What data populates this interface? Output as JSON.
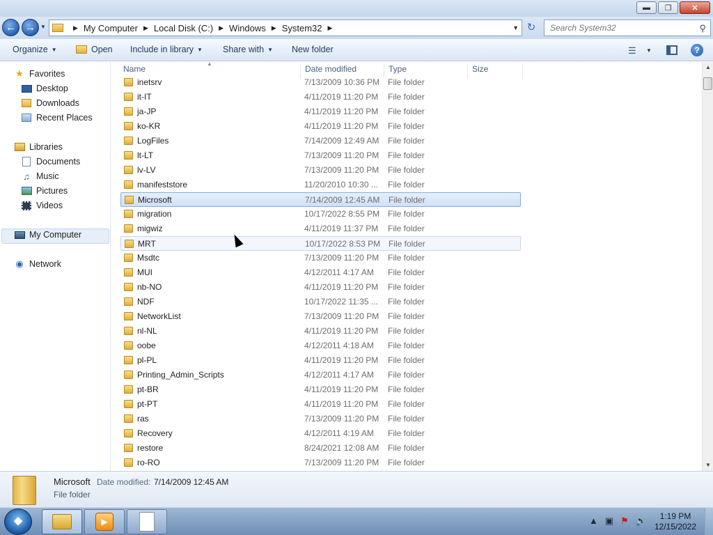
{
  "window": {
    "minimize": "▬",
    "maximize": "❐",
    "close": "✕"
  },
  "address": {
    "crumbs": [
      "My Computer",
      "Local Disk (C:)",
      "Windows",
      "System32"
    ],
    "search_placeholder": "Search System32"
  },
  "toolbar": {
    "organize": "Organize",
    "open": "Open",
    "include_in_library": "Include in library",
    "share_with": "Share with",
    "new_folder": "New folder"
  },
  "nav": {
    "favorites": "Favorites",
    "desktop": "Desktop",
    "downloads": "Downloads",
    "recent_places": "Recent Places",
    "libraries": "Libraries",
    "documents": "Documents",
    "music": "Music",
    "pictures": "Pictures",
    "videos": "Videos",
    "my_computer": "My Computer",
    "network": "Network"
  },
  "columns": {
    "name": "Name",
    "date_modified": "Date modified",
    "type": "Type",
    "size": "Size"
  },
  "files": [
    {
      "name": "inetsrv",
      "date": "7/13/2009 10:36 PM",
      "type": "File folder"
    },
    {
      "name": "it-IT",
      "date": "4/11/2019 11:20 PM",
      "type": "File folder"
    },
    {
      "name": "ja-JP",
      "date": "4/11/2019 11:20 PM",
      "type": "File folder"
    },
    {
      "name": "ko-KR",
      "date": "4/11/2019 11:20 PM",
      "type": "File folder"
    },
    {
      "name": "LogFiles",
      "date": "7/14/2009 12:49 AM",
      "type": "File folder"
    },
    {
      "name": "lt-LT",
      "date": "7/13/2009 11:20 PM",
      "type": "File folder"
    },
    {
      "name": "lv-LV",
      "date": "7/13/2009 11:20 PM",
      "type": "File folder"
    },
    {
      "name": "manifeststore",
      "date": "11/20/2010 10:30 ...",
      "type": "File folder"
    },
    {
      "name": "Microsoft",
      "date": "7/14/2009 12:45 AM",
      "type": "File folder"
    },
    {
      "name": "migration",
      "date": "10/17/2022 8:55 PM",
      "type": "File folder"
    },
    {
      "name": "migwiz",
      "date": "4/11/2019 11:37 PM",
      "type": "File folder"
    },
    {
      "name": "MRT",
      "date": "10/17/2022 8:53 PM",
      "type": "File folder"
    },
    {
      "name": "Msdtc",
      "date": "7/13/2009 11:20 PM",
      "type": "File folder"
    },
    {
      "name": "MUI",
      "date": "4/12/2011 4:17 AM",
      "type": "File folder"
    },
    {
      "name": "nb-NO",
      "date": "4/11/2019 11:20 PM",
      "type": "File folder"
    },
    {
      "name": "NDF",
      "date": "10/17/2022 11:35 ...",
      "type": "File folder"
    },
    {
      "name": "NetworkList",
      "date": "7/13/2009 11:20 PM",
      "type": "File folder"
    },
    {
      "name": "nl-NL",
      "date": "4/11/2019 11:20 PM",
      "type": "File folder"
    },
    {
      "name": "oobe",
      "date": "4/12/2011 4:18 AM",
      "type": "File folder"
    },
    {
      "name": "pl-PL",
      "date": "4/11/2019 11:20 PM",
      "type": "File folder"
    },
    {
      "name": "Printing_Admin_Scripts",
      "date": "4/12/2011 4:17 AM",
      "type": "File folder"
    },
    {
      "name": "pt-BR",
      "date": "4/11/2019 11:20 PM",
      "type": "File folder"
    },
    {
      "name": "pt-PT",
      "date": "4/11/2019 11:20 PM",
      "type": "File folder"
    },
    {
      "name": "ras",
      "date": "7/13/2009 11:20 PM",
      "type": "File folder"
    },
    {
      "name": "Recovery",
      "date": "4/12/2011 4:19 AM",
      "type": "File folder"
    },
    {
      "name": "restore",
      "date": "8/24/2021 12:08 AM",
      "type": "File folder"
    },
    {
      "name": "ro-RO",
      "date": "7/13/2009 11:20 PM",
      "type": "File folder"
    }
  ],
  "selected_index": 8,
  "hover_index": 11,
  "details": {
    "name": "Microsoft",
    "date_label": "Date modified:",
    "date_value": "7/14/2009 12:45 AM",
    "type": "File folder"
  },
  "taskbar": {
    "time": "1:19 PM",
    "date": "12/15/2022"
  },
  "icons": {
    "back": "back-arrow-icon",
    "forward": "forward-arrow-icon",
    "search": "search-icon",
    "folder": "folder-icon",
    "help": "help-icon"
  },
  "colors": {
    "selection": "#cfe1f6",
    "selection_border": "#84acdd",
    "accent": "#1e395b"
  }
}
